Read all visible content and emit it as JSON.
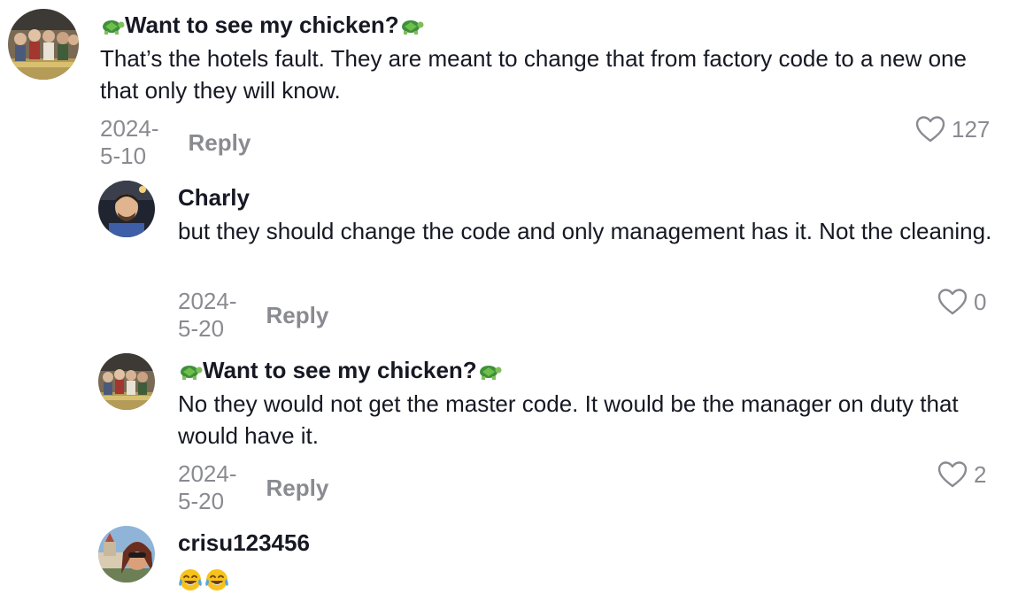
{
  "comments": [
    {
      "username": "Want to see my chicken?",
      "text": "That’s the hotels fault. They are meant to change that from factory code to a new one that only they will know.",
      "date": "2024-5-10",
      "reply_label": "Reply",
      "likes": "127"
    },
    {
      "username": "Charly",
      "text": "but they should change the code and only management has it. Not the cleaning.",
      "date": "2024-5-20",
      "reply_label": "Reply",
      "likes": "0"
    },
    {
      "username": "Want to see my chicken?",
      "text": "No they would not get the master code. It would be the manager on duty that would have it.",
      "date": "2024-5-20",
      "reply_label": "Reply",
      "likes": "2"
    },
    {
      "username": "crisu123456",
      "text": "",
      "date": "",
      "reply_label": "",
      "likes": ""
    }
  ],
  "colors": {
    "text": "#161823",
    "muted": "#8a8b91",
    "turtle": "#3f8f3a"
  },
  "icons": {
    "like": "heart-outline-icon",
    "username_decoration": "turtle-emoji-icon",
    "reaction": "tears-of-joy-emoji-icon"
  }
}
